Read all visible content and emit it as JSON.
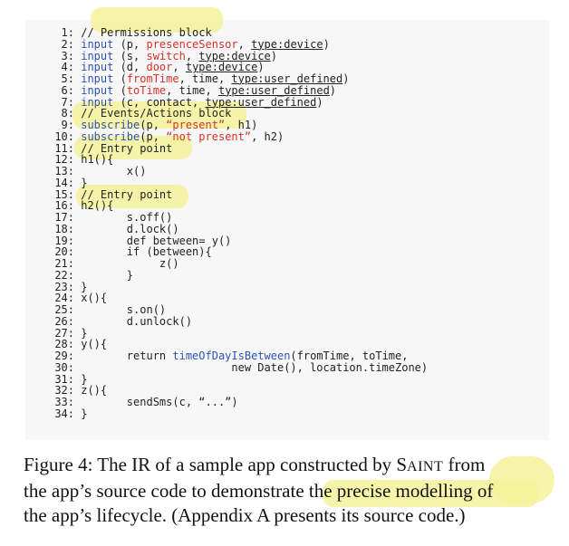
{
  "code_lines": [
    {
      "n": "1:",
      "indent": "",
      "tokens": [
        {
          "t": "// Permissions block"
        }
      ]
    },
    {
      "n": "2:",
      "indent": "",
      "tokens": [
        {
          "t": "input",
          "c": "blue"
        },
        {
          "t": " (p, "
        },
        {
          "t": "presenceSensor",
          "c": "red"
        },
        {
          "t": ", "
        },
        {
          "t": "type:device",
          "u": true
        },
        {
          "t": ")"
        }
      ]
    },
    {
      "n": "3:",
      "indent": "",
      "tokens": [
        {
          "t": "input",
          "c": "blue"
        },
        {
          "t": " (s, "
        },
        {
          "t": "switch",
          "c": "red"
        },
        {
          "t": ", "
        },
        {
          "t": "type:device",
          "u": true
        },
        {
          "t": ")"
        }
      ]
    },
    {
      "n": "4:",
      "indent": "",
      "tokens": [
        {
          "t": "input",
          "c": "blue"
        },
        {
          "t": " (d, "
        },
        {
          "t": "door",
          "c": "red"
        },
        {
          "t": ", "
        },
        {
          "t": "type:device",
          "u": true
        },
        {
          "t": ")"
        }
      ]
    },
    {
      "n": "5:",
      "indent": "",
      "tokens": [
        {
          "t": "input",
          "c": "blue"
        },
        {
          "t": " ("
        },
        {
          "t": "fromTime",
          "c": "red"
        },
        {
          "t": ", time, "
        },
        {
          "t": "type:user_defined",
          "u": true
        },
        {
          "t": ")"
        }
      ]
    },
    {
      "n": "6:",
      "indent": "",
      "tokens": [
        {
          "t": "input",
          "c": "blue"
        },
        {
          "t": " ("
        },
        {
          "t": "toTime",
          "c": "red"
        },
        {
          "t": ", time, "
        },
        {
          "t": "type:user_defined",
          "u": true
        },
        {
          "t": ")"
        }
      ]
    },
    {
      "n": "7:",
      "indent": "",
      "tokens": [
        {
          "t": "input",
          "c": "blue"
        },
        {
          "t": " (c, contact, "
        },
        {
          "t": "type:user_defined",
          "u": true
        },
        {
          "t": ")"
        }
      ]
    },
    {
      "n": "8:",
      "indent": "",
      "tokens": [
        {
          "t": "// Events/Actions block"
        }
      ]
    },
    {
      "n": "9:",
      "indent": "",
      "tokens": [
        {
          "t": "subscribe",
          "c": "blue"
        },
        {
          "t": "(p, "
        },
        {
          "t": "“present”",
          "c": "red"
        },
        {
          "t": ", h1)"
        }
      ]
    },
    {
      "n": "10:",
      "indent": "",
      "tokens": [
        {
          "t": "subscribe",
          "c": "blue"
        },
        {
          "t": "(p, "
        },
        {
          "t": "“not present”",
          "c": "red"
        },
        {
          "t": ", h2)"
        }
      ]
    },
    {
      "n": "11:",
      "indent": "",
      "tokens": [
        {
          "t": "// Entry point"
        }
      ]
    },
    {
      "n": "12:",
      "indent": "",
      "tokens": [
        {
          "t": "h1(){"
        }
      ]
    },
    {
      "n": "13:",
      "indent": "       ",
      "tokens": [
        {
          "t": "x()"
        }
      ]
    },
    {
      "n": "14:",
      "indent": "",
      "tokens": [
        {
          "t": "}"
        }
      ]
    },
    {
      "n": "15:",
      "indent": "",
      "tokens": [
        {
          "t": "// Entry point"
        }
      ]
    },
    {
      "n": "16:",
      "indent": "",
      "tokens": [
        {
          "t": "h2(){"
        }
      ]
    },
    {
      "n": "17:",
      "indent": "       ",
      "tokens": [
        {
          "t": "s.off()"
        }
      ]
    },
    {
      "n": "18:",
      "indent": "       ",
      "tokens": [
        {
          "t": "d.lock()"
        }
      ]
    },
    {
      "n": "19:",
      "indent": "       ",
      "tokens": [
        {
          "t": "def between= y()"
        }
      ]
    },
    {
      "n": "20:",
      "indent": "       ",
      "tokens": [
        {
          "t": "if (between){"
        }
      ]
    },
    {
      "n": "21:",
      "indent": "            ",
      "tokens": [
        {
          "t": "z()"
        }
      ]
    },
    {
      "n": "22:",
      "indent": "       ",
      "tokens": [
        {
          "t": "}"
        }
      ]
    },
    {
      "n": "23:",
      "indent": "",
      "tokens": [
        {
          "t": "}"
        }
      ]
    },
    {
      "n": "24:",
      "indent": "",
      "tokens": [
        {
          "t": "x(){"
        }
      ]
    },
    {
      "n": "25:",
      "indent": "       ",
      "tokens": [
        {
          "t": "s.on()"
        }
      ]
    },
    {
      "n": "26:",
      "indent": "       ",
      "tokens": [
        {
          "t": "d.unlock()"
        }
      ]
    },
    {
      "n": "27:",
      "indent": "",
      "tokens": [
        {
          "t": "}"
        }
      ]
    },
    {
      "n": "28:",
      "indent": "",
      "tokens": [
        {
          "t": "y(){"
        }
      ]
    },
    {
      "n": "29:",
      "indent": "       ",
      "tokens": [
        {
          "t": "return "
        },
        {
          "t": "timeOfDayIsBetween",
          "c": "blue"
        },
        {
          "t": "(fromTime, toTime,"
        }
      ]
    },
    {
      "n": "30:",
      "indent": "                       ",
      "tokens": [
        {
          "t": "new Date(), location.timeZone)"
        }
      ]
    },
    {
      "n": "31:",
      "indent": "",
      "tokens": [
        {
          "t": "}"
        }
      ]
    },
    {
      "n": "32:",
      "indent": "",
      "tokens": [
        {
          "t": "z(){"
        }
      ]
    },
    {
      "n": "33:",
      "indent": "       ",
      "tokens": [
        {
          "t": "sendSms(c, “...”)"
        }
      ]
    },
    {
      "n": "34:",
      "indent": "",
      "tokens": [
        {
          "t": "}"
        }
      ]
    }
  ],
  "caption": {
    "line1_a": "Figure 4: The IR of a sample app constructed by S",
    "line1_sc": "AINT",
    "line1_b": " from",
    "line2_a": "the app’s source code to demonstrate ",
    "line2_b": "the precise modelling of",
    "line3": "the app’s lifecycle. (Appendix A presents its source code.)"
  },
  "colors": {
    "keyword": "#2b54b3",
    "string": "#d8302b",
    "highlighter": "#f5f29a",
    "panel": "#f7f7f7"
  }
}
